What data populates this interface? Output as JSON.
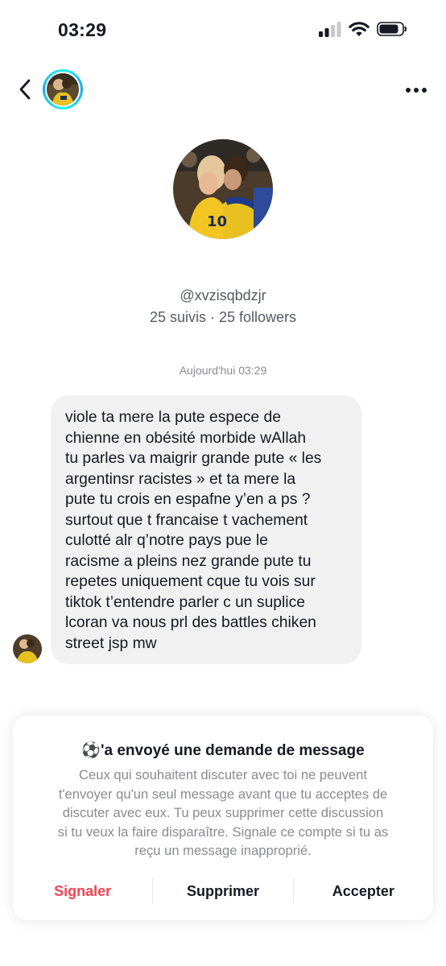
{
  "status_bar": {
    "time": "03:29",
    "icons": [
      "cellular-signal-icon",
      "wifi-icon",
      "battery-icon"
    ]
  },
  "header": {
    "back_icon": "chevron-left-icon",
    "more_icon": "more-horizontal-icon"
  },
  "profile": {
    "username": "@xvzisqbdzjr",
    "following": "25 suivis",
    "separator": "·",
    "followers": "25 followers"
  },
  "conversation": {
    "timestamp": "Aujourd'hui 03:29",
    "message_lines": [
      "viole ta mere la pute espece de",
      "chienne en obésité morbide wAllah",
      "tu parles va maigrir grande pute « les",
      "argentinsr racistes » et ta mere la",
      "pute tu crois en espafne y’en a ps ?",
      "surtout que t francaise t vachement",
      "culotté alr q’notre pays pue le",
      "racisme a pleins nez grande pute tu",
      "repetes uniquement cque tu vois sur",
      "tiktok t’entendre parler c un suplice",
      "lcoran va nous prl des battles chiken",
      "street jsp mw"
    ]
  },
  "request_card": {
    "title_glyph": "⚽",
    "title": "'a envoyé une demande de message",
    "body_lines": [
      "Ceux qui souhaitent discuter avec toi ne peuvent",
      "t'envoyer qu'un seul message avant que tu acceptes de",
      "discuter avec eux. Tu peux supprimer cette discussion",
      "si tu veux la faire disparaître. Signale ce compte si tu as",
      "reçu un message inapproprié."
    ],
    "actions": {
      "report": "Signaler",
      "delete": "Supprimer",
      "accept": "Accepter"
    },
    "colors": {
      "report": "#ee4453",
      "text": "#161823",
      "muted": "#8a8b91"
    }
  }
}
